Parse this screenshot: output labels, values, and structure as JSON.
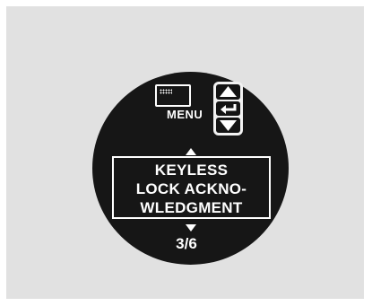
{
  "menu": {
    "label": "MENU",
    "screen_icon": "menu-screen-icon"
  },
  "nav_buttons": {
    "up_icon": "triangle-up",
    "enter_icon": "enter-return-arrow",
    "down_icon": "triangle-down"
  },
  "message": {
    "lines": [
      "KEYLESS",
      "LOCK ACKNO-",
      "WLEDGMENT"
    ]
  },
  "page_indicator": "3/6",
  "colors": {
    "background": "#e1e1e1",
    "display": "#161616",
    "foreground": "#ffffff",
    "button_pad": "#f2f2f2"
  }
}
